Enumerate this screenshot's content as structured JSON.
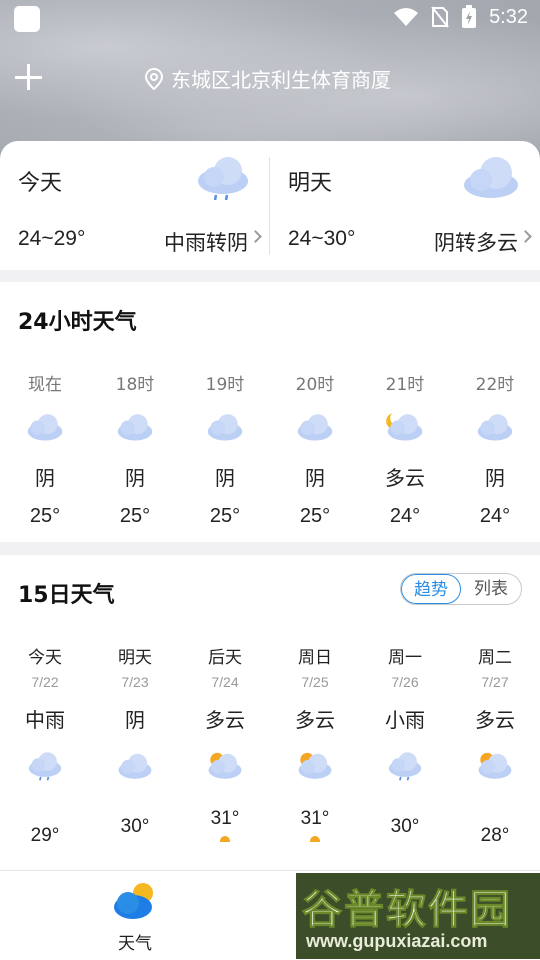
{
  "status_bar": {
    "time": "5:32"
  },
  "header": {
    "location": "东城区北京利生体育商厦"
  },
  "today": {
    "label": "今天",
    "range": "24~29°",
    "condition": "中雨转阴"
  },
  "tomorrow": {
    "label": "明天",
    "range": "24~30°",
    "condition": "阴转多云"
  },
  "hourly": {
    "title": "24小时天气",
    "items": [
      {
        "time": "现在",
        "icon": "cloudy-icon",
        "cond": "阴",
        "temp": "25°"
      },
      {
        "time": "18时",
        "icon": "cloudy-icon",
        "cond": "阴",
        "temp": "25°"
      },
      {
        "time": "19时",
        "icon": "cloudy-icon",
        "cond": "阴",
        "temp": "25°"
      },
      {
        "time": "20时",
        "icon": "cloudy-icon",
        "cond": "阴",
        "temp": "25°"
      },
      {
        "time": "21时",
        "icon": "partly-cloudy-night-icon",
        "cond": "多云",
        "temp": "24°"
      },
      {
        "time": "22时",
        "icon": "cloudy-icon",
        "cond": "阴",
        "temp": "24°"
      }
    ]
  },
  "daily": {
    "title": "15日天气",
    "toggle": {
      "trend": "趋势",
      "list": "列表"
    },
    "items": [
      {
        "name": "今天",
        "date": "7/22",
        "cond": "中雨",
        "icon": "rain-icon",
        "high": "29°"
      },
      {
        "name": "明天",
        "date": "7/23",
        "cond": "阴",
        "icon": "cloudy-icon",
        "high": "30°"
      },
      {
        "name": "后天",
        "date": "7/24",
        "cond": "多云",
        "icon": "partly-cloudy-icon",
        "high": "31°"
      },
      {
        "name": "周日",
        "date": "7/25",
        "cond": "多云",
        "icon": "partly-cloudy-icon",
        "high": "31°"
      },
      {
        "name": "周一",
        "date": "7/26",
        "cond": "小雨",
        "icon": "rain-icon",
        "high": "30°"
      },
      {
        "name": "周二",
        "date": "7/27",
        "cond": "多云",
        "icon": "partly-cloudy-icon",
        "high": "28°"
      }
    ]
  },
  "nav": {
    "weather_label": "天气"
  },
  "watermark": {
    "text": "谷普软件园",
    "url": "www.gupuxiazai.com"
  },
  "colors": {
    "accent": "#2a8ee6",
    "sun": "#f5a623",
    "cloud": "#c7d7f5"
  }
}
